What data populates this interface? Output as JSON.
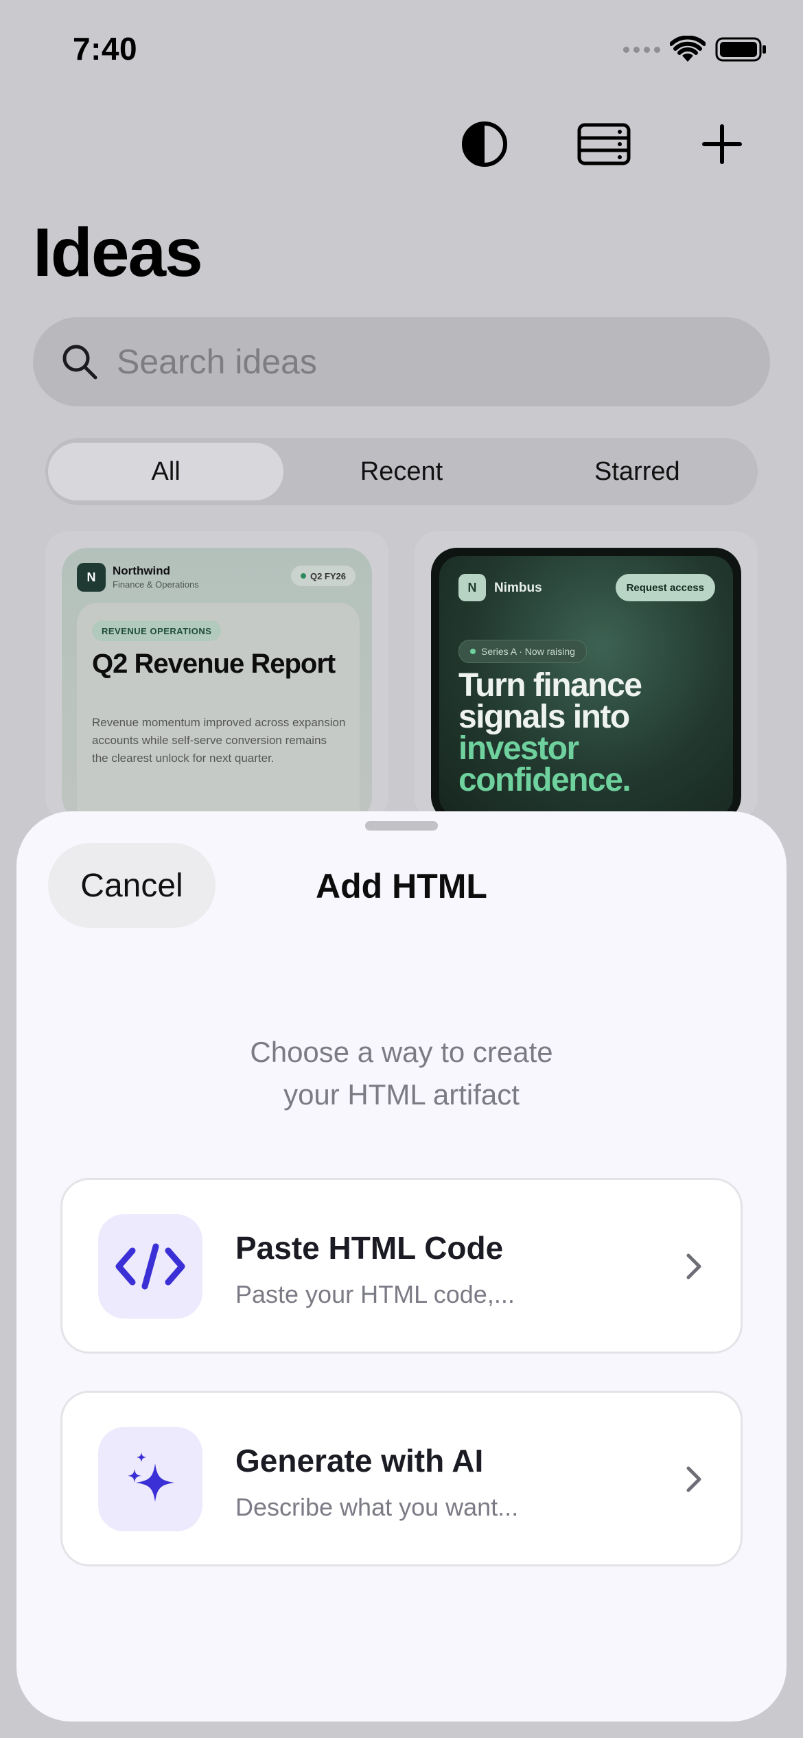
{
  "status_bar": {
    "time": "7:40"
  },
  "toolbar": {
    "appearance_icon": "half-circle-contrast-icon",
    "layout_icon": "list-layout-icon",
    "add_icon": "plus-icon"
  },
  "page": {
    "title": "Ideas"
  },
  "search": {
    "placeholder": "Search ideas",
    "icon": "search-icon"
  },
  "filters": {
    "selected": "All",
    "options": [
      "All",
      "Recent",
      "Starred"
    ]
  },
  "cards": [
    {
      "logo_letter": "N",
      "brand": "Northwind",
      "subtitle": "Finance & Operations",
      "badge": "Q2 FY26",
      "tag": "REVENUE OPERATIONS",
      "title": "Q2 Revenue Report",
      "description": "Revenue momentum improved across expansion accounts while self-serve conversion remains the clearest unlock for next quarter."
    },
    {
      "logo_letter": "N",
      "brand": "Nimbus",
      "cta": "Request access",
      "pill": "Series A · Now raising",
      "headline_line1": "Turn finance",
      "headline_line2": "signals into",
      "headline_highlight1": "investor",
      "headline_highlight2": "confidence."
    }
  ],
  "sheet": {
    "cancel_label": "Cancel",
    "title": "Add HTML",
    "subtitle_line1": "Choose a way to create",
    "subtitle_line2": "your HTML artifact",
    "options": [
      {
        "icon": "code-brackets-icon",
        "title": "Paste HTML Code",
        "description": "Paste your HTML code,..."
      },
      {
        "icon": "sparkles-icon",
        "title": "Generate with AI",
        "description": "Describe what you want..."
      }
    ],
    "accent_color": "#3b2fd6"
  }
}
